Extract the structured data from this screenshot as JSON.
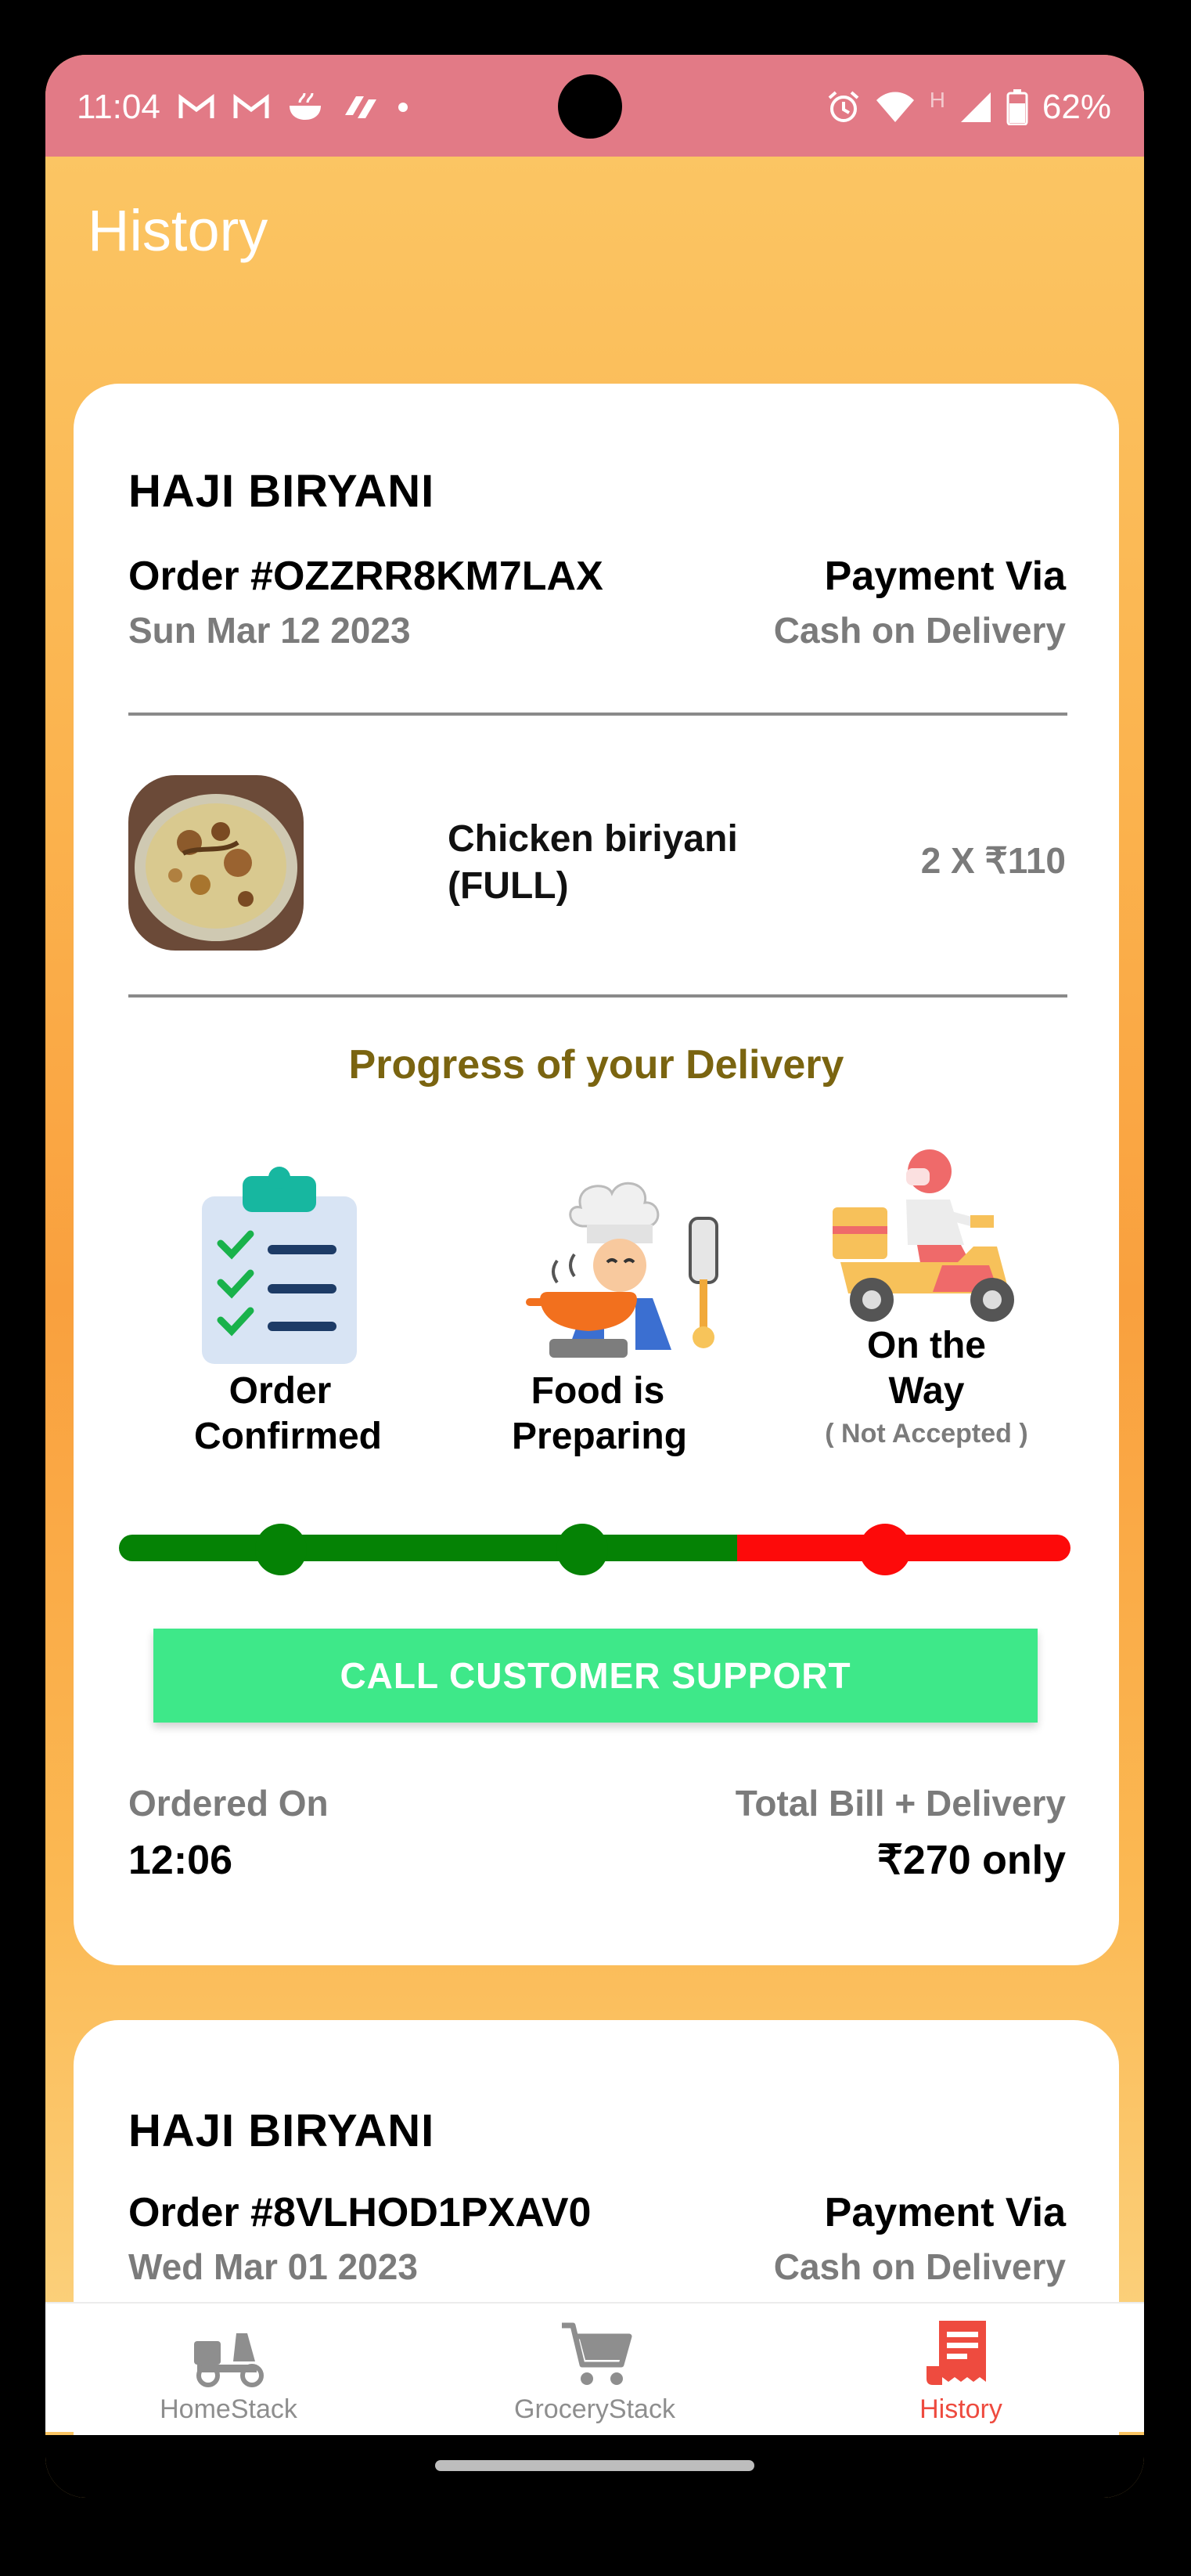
{
  "status_bar": {
    "time": "11:04",
    "battery": "62%",
    "network": "H"
  },
  "header": {
    "title": "History"
  },
  "orders": [
    {
      "restaurant": "HAJI BIRYANI",
      "order_id": "Order #OZZRR8KM7LAX",
      "date": "Sun Mar 12 2023",
      "payment_label": "Payment Via",
      "payment_method": "Cash on Delivery",
      "item_name": "Chicken biriyani (FULL)",
      "item_qty_price": "2 X ₹110",
      "progress_title": "Progress of your Delivery",
      "steps": [
        {
          "label": "Order Confirmed",
          "icon": "clipboard-checklist-icon"
        },
        {
          "label": "Food is Preparing",
          "icon": "chef-cooking-icon"
        },
        {
          "label": "On the Way",
          "sub": "( Not Accepted )",
          "icon": "delivery-scooter-icon"
        }
      ],
      "progress_colors": {
        "done": "#058205",
        "pending": "#fd0a0a"
      },
      "support_button": "CALL CUSTOMER SUPPORT",
      "ordered_on_label": "Ordered On",
      "ordered_on_time": "12:06",
      "total_label": "Total Bill + Delivery",
      "total_value": "₹270 only"
    },
    {
      "restaurant": "HAJI BIRYANI",
      "order_id": "Order #8VLHOD1PXAV0",
      "date": "Wed Mar 01 2023",
      "payment_label": "Payment Via",
      "payment_method": "Cash on Delivery"
    }
  ],
  "bottom_nav": [
    {
      "label": "HomeStack",
      "icon": "delivery-scooter-icon",
      "active": false
    },
    {
      "label": "GroceryStack",
      "icon": "shopping-cart-icon",
      "active": false
    },
    {
      "label": "History",
      "icon": "receipt-icon",
      "active": true
    }
  ],
  "colors": {
    "status_bar": "#e27a86",
    "background": "#fbc563",
    "accent_active": "#ee4b3f",
    "support_button": "#3ee889",
    "progress_title": "#7a6410"
  }
}
